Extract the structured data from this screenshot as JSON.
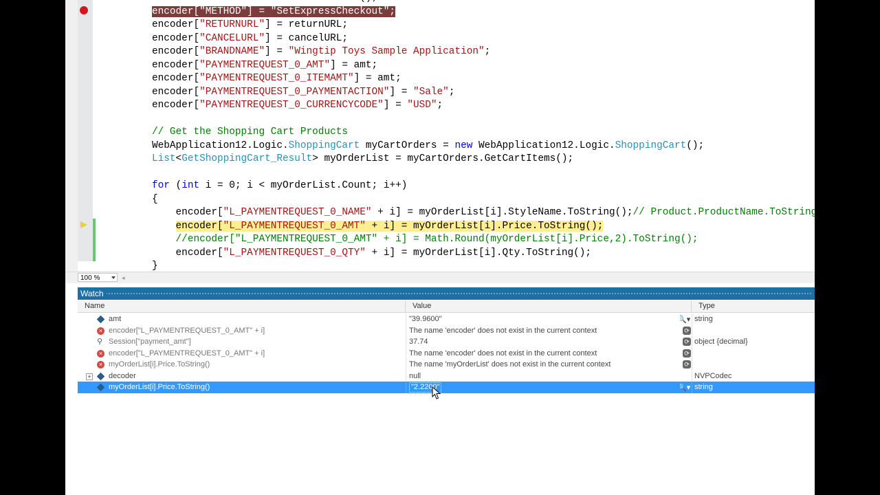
{
  "editor": {
    "lines": [
      {
        "type": "code",
        "html": "    NVPCodec encoder = new NVPCodec();"
      },
      {
        "type": "hl-red",
        "html": "encoder[\"METHOD\"] = \"SetExpressCheckout\";"
      },
      {
        "type": "code",
        "parts": [
          [
            "",
            "encoder["
          ],
          [
            "str",
            "\"RETURNURL\""
          ],
          [
            "",
            "] = returnURL;"
          ]
        ]
      },
      {
        "type": "code",
        "parts": [
          [
            "",
            "encoder["
          ],
          [
            "str",
            "\"CANCELURL\""
          ],
          [
            "",
            "] = cancelURL;"
          ]
        ]
      },
      {
        "type": "code",
        "parts": [
          [
            "",
            "encoder["
          ],
          [
            "str",
            "\"BRANDNAME\""
          ],
          [
            "",
            "] = "
          ],
          [
            "str",
            "\"Wingtip Toys Sample Application\""
          ],
          [
            "",
            ";"
          ]
        ]
      },
      {
        "type": "code",
        "parts": [
          [
            "",
            "encoder["
          ],
          [
            "str",
            "\"PAYMENTREQUEST_0_AMT\""
          ],
          [
            "",
            "] = amt;"
          ]
        ]
      },
      {
        "type": "code",
        "parts": [
          [
            "",
            "encoder["
          ],
          [
            "str",
            "\"PAYMENTREQUEST_0_ITEMAMT\""
          ],
          [
            "",
            "] = amt;"
          ]
        ]
      },
      {
        "type": "code",
        "parts": [
          [
            "",
            "encoder["
          ],
          [
            "str",
            "\"PAYMENTREQUEST_0_PAYMENTACTION\""
          ],
          [
            "",
            "] = "
          ],
          [
            "str",
            "\"Sale\""
          ],
          [
            "",
            ";"
          ]
        ]
      },
      {
        "type": "code",
        "parts": [
          [
            "",
            "encoder["
          ],
          [
            "str",
            "\"PAYMENTREQUEST_0_CURRENCYCODE\""
          ],
          [
            "",
            "] = "
          ],
          [
            "str",
            "\"USD\""
          ],
          [
            "",
            ";"
          ]
        ]
      },
      {
        "type": "code",
        "parts": [
          [
            "",
            ""
          ]
        ]
      },
      {
        "type": "code",
        "parts": [
          [
            "cm",
            "// Get the Shopping Cart Products"
          ]
        ]
      },
      {
        "type": "code",
        "parts": [
          [
            "",
            "WebApplication12.Logic."
          ],
          [
            "ty",
            "ShoppingCart"
          ],
          [
            "",
            " myCartOrders = "
          ],
          [
            "kw",
            "new"
          ],
          [
            "",
            " WebApplication12.Logic."
          ],
          [
            "ty",
            "ShoppingCart"
          ],
          [
            "",
            "();"
          ]
        ]
      },
      {
        "type": "code",
        "parts": [
          [
            "ty",
            "List"
          ],
          [
            "",
            "<"
          ],
          [
            "ty",
            "GetShoppingCart_Result"
          ],
          [
            "",
            "> myOrderList = myCartOrders.GetCartItems();"
          ]
        ]
      },
      {
        "type": "code",
        "parts": [
          [
            "",
            ""
          ]
        ]
      },
      {
        "type": "code",
        "parts": [
          [
            "kw",
            "for"
          ],
          [
            "",
            " ("
          ],
          [
            "kw",
            "int"
          ],
          [
            "",
            " i = 0; i < myOrderList.Count; i++)"
          ]
        ]
      },
      {
        "type": "code",
        "parts": [
          [
            "",
            "{"
          ]
        ]
      },
      {
        "type": "code",
        "parts": [
          [
            "",
            "    encoder["
          ],
          [
            "str",
            "\"L_PAYMENTREQUEST_0_NAME\""
          ],
          [
            "",
            " + i] = myOrderList[i].StyleName.ToString();"
          ],
          [
            "cm",
            "// Product.ProductName.ToString();"
          ]
        ]
      },
      {
        "type": "hl-yel",
        "parts": [
          [
            "",
            "    "
          ],
          [
            "y",
            "encoder["
          ],
          [
            "ystr",
            "\"L_PAYMENTREQUEST_0_AMT\""
          ],
          [
            "y",
            " + i] = myOrderList[i].Price.ToString();"
          ]
        ]
      },
      {
        "type": "code",
        "parts": [
          [
            "cm",
            "    //encoder[\"L_PAYMENTREQUEST_0_AMT\" + i] = Math.Round(myOrderList[i].Price,2).ToString();"
          ]
        ]
      },
      {
        "type": "code",
        "parts": [
          [
            "",
            "    encoder["
          ],
          [
            "str",
            "\"L_PAYMENTREQUEST_0_QTY\""
          ],
          [
            "",
            " + i] = myOrderList[i].Qty.ToString();"
          ]
        ]
      },
      {
        "type": "code",
        "parts": [
          [
            "",
            "}"
          ]
        ]
      }
    ]
  },
  "zoom": {
    "level": "100 %"
  },
  "watch": {
    "title": "Watch",
    "columns": {
      "name": "Name",
      "value": "Value",
      "type": "Type"
    },
    "rows": [
      {
        "icon": "object-icon",
        "name": "amt",
        "value": "\"39.9600\"",
        "type": "string",
        "button": "magnifier",
        "expand": false,
        "err": false
      },
      {
        "icon": "error-icon",
        "name": "encoder[\"L_PAYMENTREQUEST_0_AMT\" + i]",
        "value": "The name 'encoder' does not exist in the current context",
        "type": "",
        "button": "refresh",
        "expand": false,
        "err": true
      },
      {
        "icon": "property-icon",
        "name": "Session[\"payment_amt\"]",
        "value": "37.74",
        "type": "object {decimal}",
        "button": "refresh",
        "expand": false,
        "err": true
      },
      {
        "icon": "error-icon",
        "name": "encoder[\"L_PAYMENTREQUEST_0_AMT\" + i]",
        "value": "The name 'encoder' does not exist in the current context",
        "type": "",
        "button": "refresh",
        "expand": false,
        "err": true
      },
      {
        "icon": "error-icon",
        "name": "myOrderList[i].Price.ToString()",
        "value": "The name 'myOrderList' does not exist in the current context",
        "type": "",
        "button": "refresh",
        "expand": false,
        "err": true
      },
      {
        "icon": "object-icon",
        "name": "decoder",
        "value": "null",
        "type": "NVPCodec",
        "button": "",
        "expand": true,
        "err": false
      },
      {
        "icon": "object-icon",
        "name": "myOrderList[i].Price.ToString()",
        "value": "\"2.2200\"",
        "type": "string",
        "button": "magnifier",
        "expand": false,
        "err": false,
        "selected": true
      }
    ]
  }
}
